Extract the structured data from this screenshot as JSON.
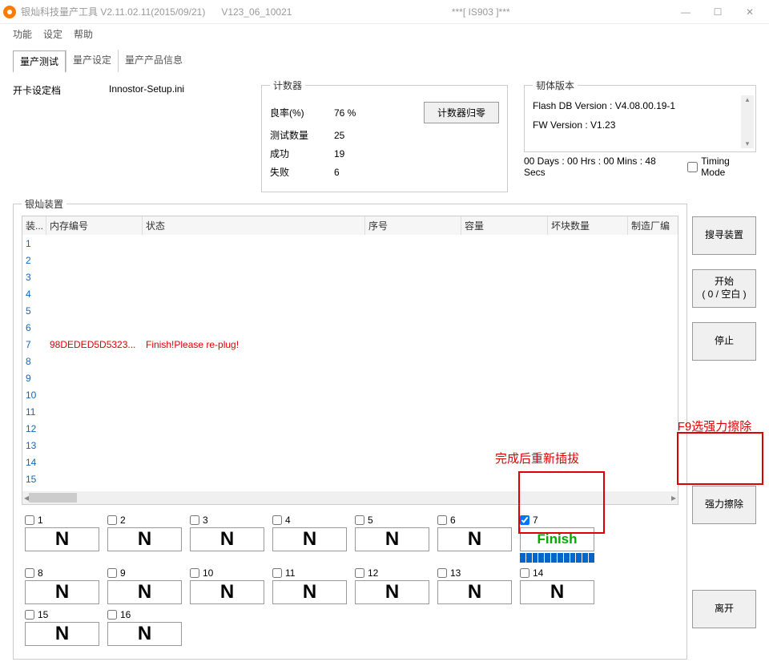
{
  "title": {
    "app": "银灿科技量产工具 V2.11.02.11(2015/09/21)",
    "ver": "V123_06_10021",
    "device": "***[ IS903 ]***"
  },
  "winbtns": {
    "min": "—",
    "max": "☐",
    "close": "✕"
  },
  "menu": {
    "func": "功能",
    "set": "设定",
    "help": "帮助"
  },
  "tabs": {
    "t1": "量产测试",
    "t2": "量产设定",
    "t3": "量产产品信息"
  },
  "file": {
    "label": "开卡设定档",
    "name": "Innostor-Setup.ini"
  },
  "counter": {
    "legend": "计数器",
    "reset": "计数器归零",
    "rows": [
      {
        "label": "良率(%)",
        "val": "76 %"
      },
      {
        "label": "测试数量",
        "val": "25"
      },
      {
        "label": "成功",
        "val": "19"
      },
      {
        "label": "失败",
        "val": "6"
      }
    ]
  },
  "fw": {
    "legend": "韧体版本",
    "l1": "Flash DB Version :  V4.08.00.19-1",
    "l2": "FW Version :   V1.23"
  },
  "timer": "00 Days : 00 Hrs : 00 Mins : 48 Secs",
  "timing": "Timing Mode",
  "devlegend": "银灿装置",
  "cols": {
    "c0": "装...",
    "c1": "内存编号",
    "c2": "状态",
    "c3": "序号",
    "c4": "容量",
    "c5": "坏块数量",
    "c6": "制造厂编"
  },
  "rows": [
    {
      "n": "1"
    },
    {
      "n": "2"
    },
    {
      "n": "3"
    },
    {
      "n": "4"
    },
    {
      "n": "5"
    },
    {
      "n": "6"
    },
    {
      "n": "7",
      "mem": "98DEDED5D5323...",
      "st": "Finish!Please re-plug!",
      "red": true
    },
    {
      "n": "8"
    },
    {
      "n": "9"
    },
    {
      "n": "10"
    },
    {
      "n": "11"
    },
    {
      "n": "12"
    },
    {
      "n": "13"
    },
    {
      "n": "14"
    },
    {
      "n": "15"
    }
  ],
  "sidebtns": {
    "search": "搜寻装置",
    "start": "开始\n( 0 / 空白  )",
    "stop": "停止",
    "erase": "强力擦除",
    "exit": "离开"
  },
  "annot": {
    "a1": "F9选强力擦除",
    "a2": "完成后重新插拔"
  },
  "slots": [
    {
      "n": "1",
      "body": "N"
    },
    {
      "n": "2",
      "body": "N"
    },
    {
      "n": "3",
      "body": "N"
    },
    {
      "n": "4",
      "body": "N"
    },
    {
      "n": "5",
      "body": "N"
    },
    {
      "n": "6",
      "body": "N"
    },
    {
      "n": "7",
      "body": "Finish",
      "checked": true,
      "finish": true,
      "prog": true
    },
    {
      "n": "8",
      "body": "N"
    },
    {
      "n": "9",
      "body": "N"
    },
    {
      "n": "10",
      "body": "N"
    },
    {
      "n": "11",
      "body": "N"
    },
    {
      "n": "12",
      "body": "N"
    },
    {
      "n": "13",
      "body": "N"
    },
    {
      "n": "14",
      "body": "N"
    },
    {
      "n": "15",
      "body": "N"
    },
    {
      "n": "16",
      "body": "N"
    }
  ]
}
